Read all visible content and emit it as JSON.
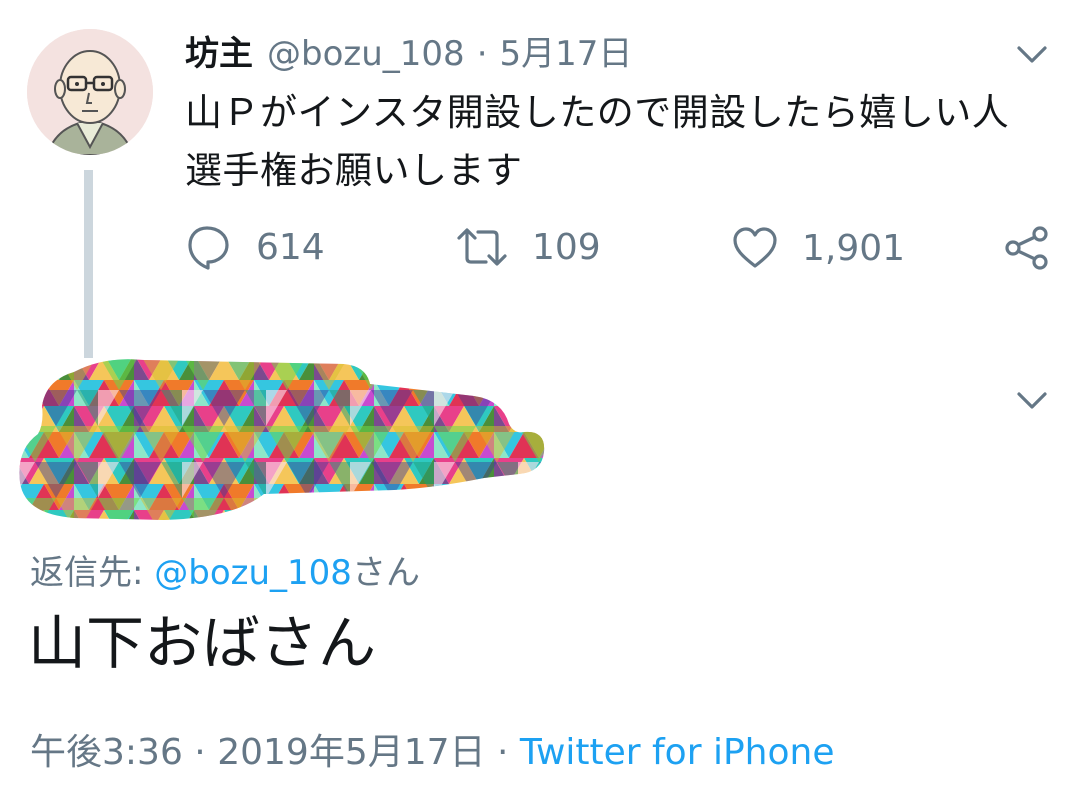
{
  "tweet": {
    "author_name": "坊主",
    "author_handle": "@bozu_108",
    "separator": "·",
    "date": "5月17日",
    "text": "山Ｐがインスタ開設したので開設したら嬉しい人選手権お願いします",
    "actions": {
      "reply_count": "614",
      "retweet_count": "109",
      "like_count": "1,901"
    }
  },
  "reply": {
    "reply_to_label": "返信先: ",
    "reply_to_handle": "@bozu_108",
    "reply_to_suffix": "さん",
    "text": "山下おばさん",
    "time": "午後3:36",
    "separator": "·",
    "full_date": "2019年5月17日",
    "source": "Twitter for iPhone"
  },
  "icons": {
    "chevron": "chevron-down-icon",
    "reply": "reply-bubble-icon",
    "retweet": "retweet-icon",
    "like": "heart-icon",
    "share": "share-icon"
  },
  "colors": {
    "primary_text": "#14171a",
    "secondary_text": "#657786",
    "link": "#1da1f2",
    "thread_line": "#ccd6dd"
  }
}
